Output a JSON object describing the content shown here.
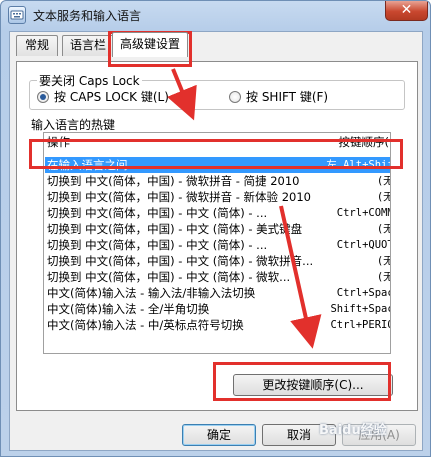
{
  "window": {
    "title": "文本服务和输入语言",
    "close_label": "✕"
  },
  "tabs": [
    {
      "label": "常规"
    },
    {
      "label": "语言栏"
    },
    {
      "label": "高级键设置"
    }
  ],
  "caps_lock": {
    "group_label": "要关闭 Caps Lock",
    "options": [
      {
        "label": "按 CAPS LOCK 键(L)",
        "selected": true
      },
      {
        "label": "按 SHIFT 键(F)",
        "selected": false
      }
    ]
  },
  "hotkeys": {
    "group_label": "输入语言的热键",
    "columns": {
      "action": "操作",
      "key": "按键顺序(K)"
    },
    "rows": [
      {
        "action": "在输入语言之间",
        "key": "左 Alt+Shift",
        "selected": true
      },
      {
        "action": "切换到 中文(简体，中国) - 微软拼音 - 简捷 2010",
        "key": "(无)",
        "selected": false
      },
      {
        "action": "切换到 中文(简体，中国) - 微软拼音 - 新体验 2010",
        "key": "(无)",
        "selected": false
      },
      {
        "action": "切换到 中文(简体，中国) - 中文 (简体) - ...",
        "key": "Ctrl+COMMA",
        "selected": false
      },
      {
        "action": "切换到 中文(简体，中国) - 中文 (简体) - 美式键盘",
        "key": "(无)",
        "selected": false
      },
      {
        "action": "切换到 中文(简体，中国) - 中文 (简体) - ...",
        "key": "Ctrl+QUOTE",
        "selected": false
      },
      {
        "action": "切换到 中文(简体，中国) - 中文 (简体) - 微软拼音...",
        "key": "(无)",
        "selected": false
      },
      {
        "action": "切换到 中文(简体，中国) - 中文 (简体) - 微软...",
        "key": "(无)",
        "selected": false
      },
      {
        "action": "中文(简体)输入法 - 输入法/非输入法切换",
        "key": "Ctrl+Space",
        "selected": false
      },
      {
        "action": "中文(简体)输入法 - 全/半角切换",
        "key": "Shift+Space",
        "selected": false
      },
      {
        "action": "中文(简体)输入法 - 中/英标点符号切换",
        "key": "Ctrl+PERIOD",
        "selected": false
      }
    ],
    "change_button": "更改按键顺序(C)..."
  },
  "buttons": {
    "ok": "确定",
    "cancel": "取消",
    "apply": "应用(A)"
  },
  "annotation_color": "#e2302c",
  "watermark": "Baidu经验"
}
